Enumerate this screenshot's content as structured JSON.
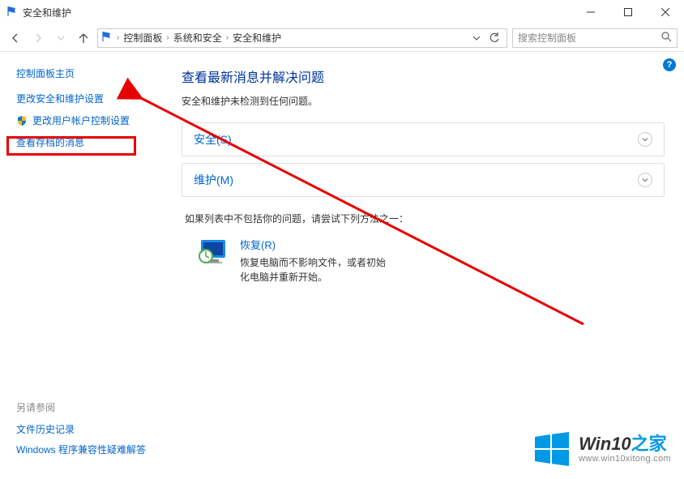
{
  "window": {
    "title": "安全和维护",
    "buttons": {
      "min": "minimize",
      "max": "maximize",
      "close": "close"
    }
  },
  "nav": {
    "back": "返回",
    "forward": "前进",
    "up": "上移"
  },
  "breadcrumb": {
    "items": [
      "控制面板",
      "系统和安全",
      "安全和维护"
    ]
  },
  "search": {
    "placeholder": "搜索控制面板"
  },
  "sidebar": {
    "home": "控制面板主页",
    "links": [
      {
        "label": "更改安全和维护设置",
        "shield": false,
        "highlighted": true
      },
      {
        "label": "更改用户帐户控制设置",
        "shield": true
      },
      {
        "label": "查看存档的消息",
        "shield": false
      }
    ],
    "seealso": {
      "header": "另请参阅",
      "items": [
        "文件历史记录",
        "Windows 程序兼容性疑难解答"
      ]
    }
  },
  "main": {
    "heading": "查看最新消息并解决问题",
    "subtitle": "安全和维护未检测到任何问题。",
    "sections": [
      {
        "title": "安全(S)"
      },
      {
        "title": "维护(M)"
      }
    ],
    "try_text": "如果列表中不包括你的问题，请尝试下列方法之一：",
    "recovery": {
      "title": "恢复(R)",
      "desc": "恢复电脑而不影响文件，或者初始化电脑并重新开始。"
    }
  },
  "help": "?",
  "watermark": {
    "brand_main": "Win10",
    "brand_suffix": "之家",
    "url": "www.win10xitong.com"
  }
}
